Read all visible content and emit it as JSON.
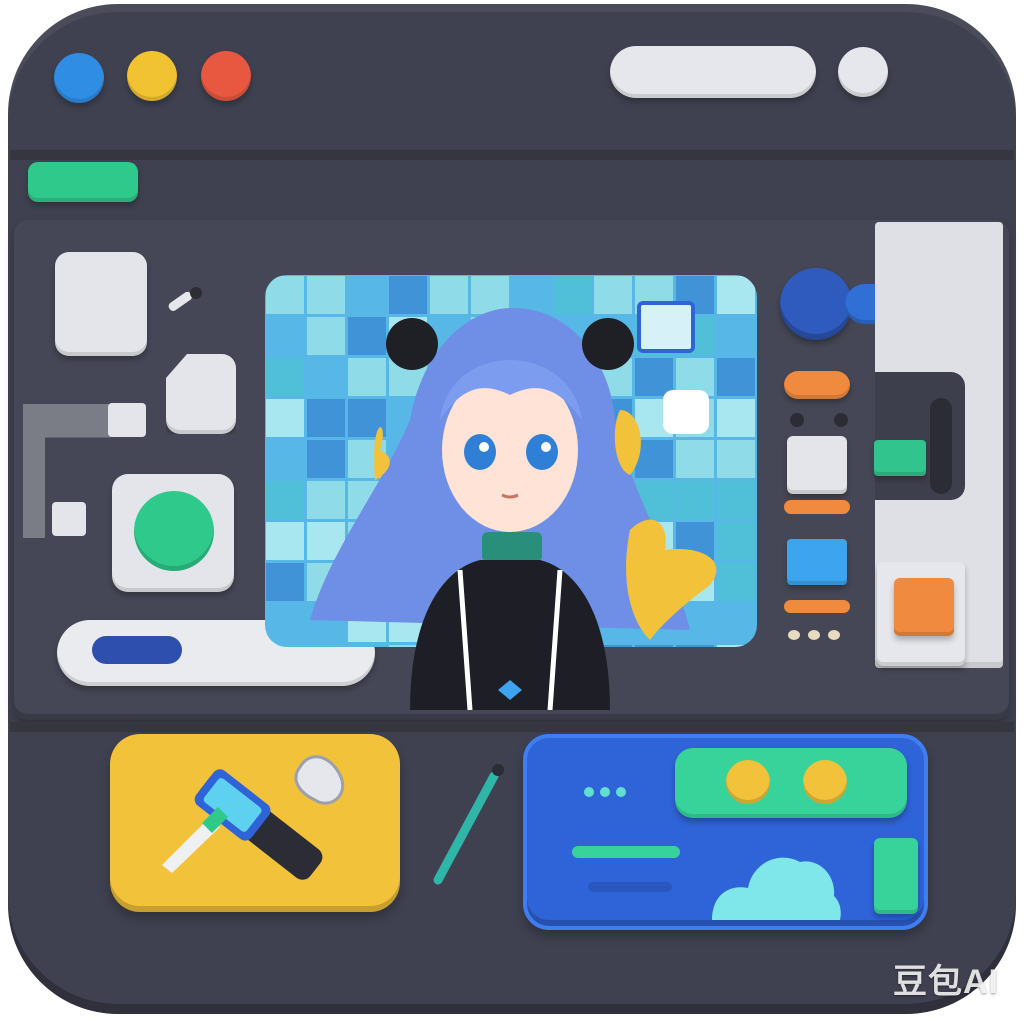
{
  "window": {
    "traffic_lights": [
      {
        "name": "close",
        "color": "#2f8de4"
      },
      {
        "name": "minimize",
        "color": "#f1c232"
      },
      {
        "name": "maximize",
        "color": "#e8573f"
      }
    ],
    "address_bar": {
      "placeholder": ""
    },
    "accent_tab_color": "#2fc98b"
  },
  "preview": {
    "character": "anime-girl-avatar",
    "background_tiles_colors": [
      "#57b7e6",
      "#3f93d6",
      "#8fdbe8",
      "#a9e7f0",
      "#4fc0d8"
    ]
  },
  "controls": {
    "toggle_color": "#2f5bbf",
    "slider_fill": "#2f6fd6",
    "swatches": [
      "#f08a3e",
      "#e4e5ea",
      "#31c48d",
      "#3da4f0",
      "#f08a3e"
    ],
    "progress_color": "#2f4fae"
  },
  "dock": {
    "tools_card_color": "#f2c23b",
    "info_card_color": "#2f63d8",
    "info_card_accent": "#37d39a"
  },
  "watermark": {
    "text": "豆包AI"
  }
}
